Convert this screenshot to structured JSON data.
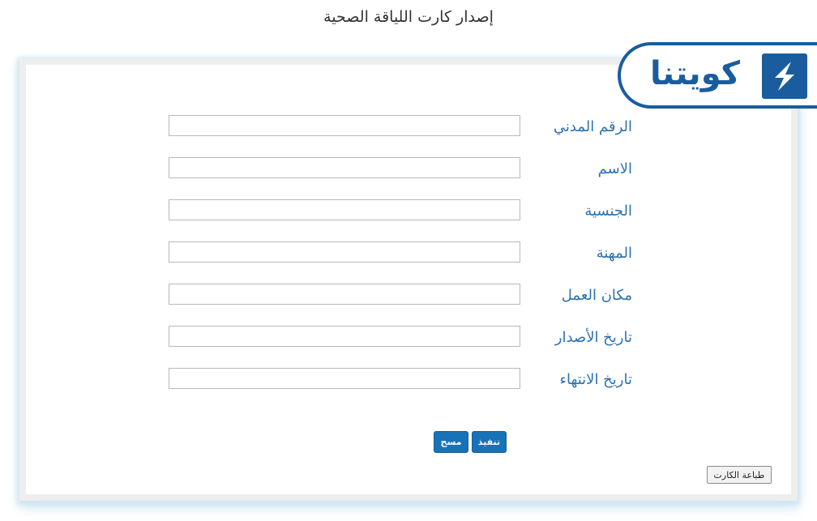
{
  "page": {
    "title": "إصدار كارت اللياقة الصحية"
  },
  "logo": {
    "text": "كويتنا",
    "icon": "lightning-s-icon",
    "color": "#1a5d9e"
  },
  "form": {
    "fields": [
      {
        "label": "الرقم المدني",
        "value": ""
      },
      {
        "label": "الاسم",
        "value": ""
      },
      {
        "label": "الجنسية",
        "value": ""
      },
      {
        "label": "المهنة",
        "value": ""
      },
      {
        "label": "مكان العمل",
        "value": ""
      },
      {
        "label": "تاريخ الأصدار",
        "value": ""
      },
      {
        "label": "تاريخ الانتهاء",
        "value": ""
      }
    ]
  },
  "buttons": {
    "execute": "تنفيذ",
    "clear": "مسح",
    "print": "طباعة الكارت"
  },
  "colors": {
    "label": "#2c72b0",
    "button": "#1772b8",
    "accent": "#1a5d9e"
  }
}
